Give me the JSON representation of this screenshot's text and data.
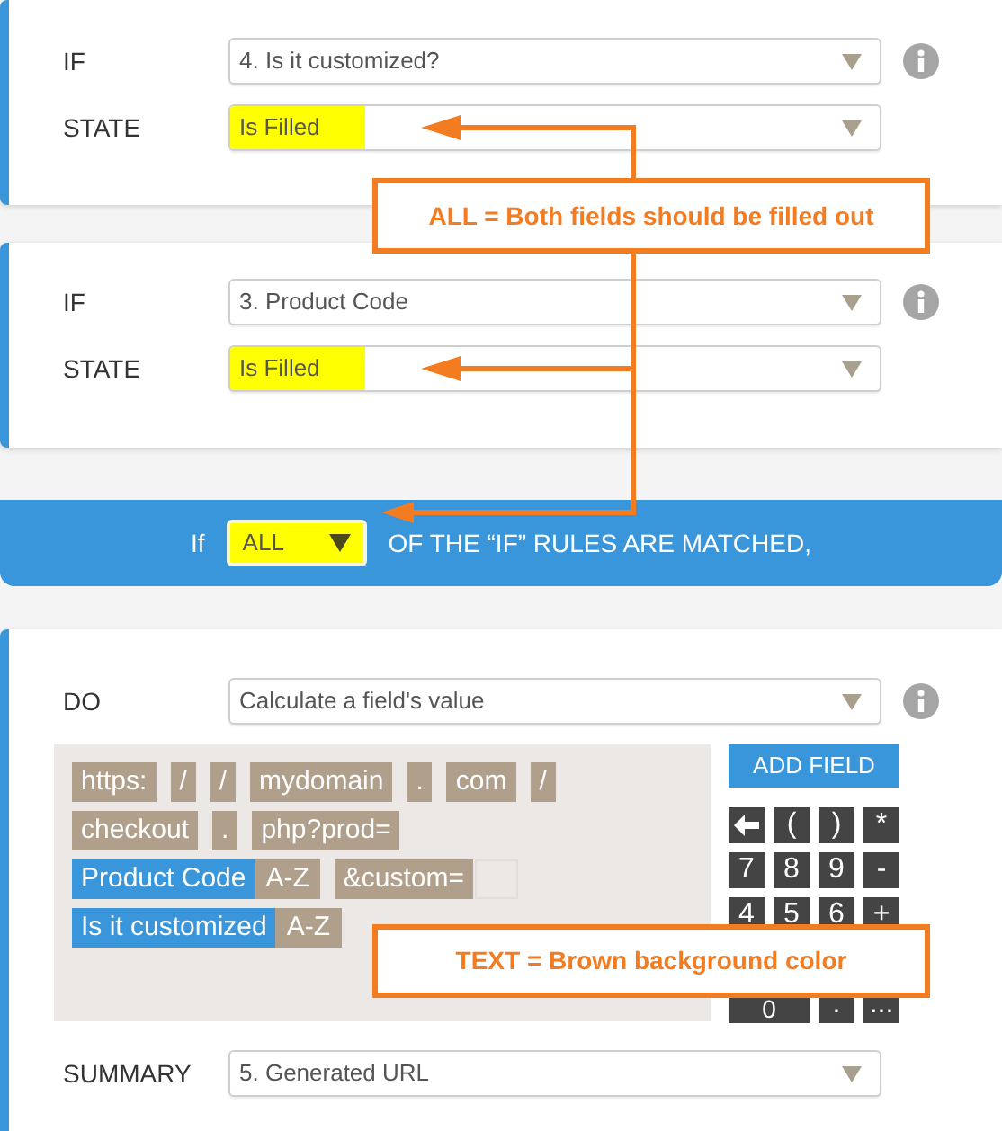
{
  "conditions": [
    {
      "rows": [
        {
          "label": "IF",
          "value": "4. Is it customized?",
          "highlight": false,
          "info": true
        },
        {
          "label": "STATE",
          "value": "Is Filled",
          "highlight": true,
          "info": false
        }
      ]
    },
    {
      "rows": [
        {
          "label": "IF",
          "value": "3. Product Code",
          "highlight": false,
          "info": true
        },
        {
          "label": "STATE",
          "value": "Is Filled",
          "highlight": true,
          "info": false
        }
      ]
    }
  ],
  "match_bar": {
    "prefix": "If",
    "select": "ALL",
    "suffix": "OF THE “IF” RULES ARE MATCHED,"
  },
  "action": {
    "do_label": "DO",
    "do_value": "Calculate a field's value",
    "token_lines": [
      [
        {
          "kind": "text",
          "label": "https:"
        },
        {
          "kind": "text",
          "label": "/"
        },
        {
          "kind": "text",
          "label": "/"
        },
        {
          "kind": "text",
          "label": "mydomain"
        },
        {
          "kind": "text",
          "label": "."
        },
        {
          "kind": "text",
          "label": "com"
        },
        {
          "kind": "text",
          "label": "/"
        }
      ],
      [
        {
          "kind": "text",
          "label": "checkout"
        },
        {
          "kind": "text",
          "label": "."
        },
        {
          "kind": "text",
          "label": "php?prod="
        }
      ],
      [
        {
          "kind": "field",
          "label": "Product Code",
          "format": "A-Z"
        },
        {
          "kind": "text",
          "label": "&custom="
        },
        {
          "kind": "input"
        }
      ],
      [
        {
          "kind": "field",
          "label": "Is it customized",
          "format": "A-Z"
        }
      ]
    ],
    "add_field": "ADD FIELD",
    "keypad": [
      [
        {
          "kind": "icon"
        },
        {
          "kind": "text",
          "label": "("
        },
        {
          "kind": "text",
          "label": ")"
        },
        {
          "kind": "text",
          "label": "*"
        }
      ],
      [
        {
          "kind": "text",
          "label": "7"
        },
        {
          "kind": "text",
          "label": "8"
        },
        {
          "kind": "text",
          "label": "9"
        },
        {
          "kind": "text",
          "label": "-"
        }
      ],
      [
        {
          "kind": "text",
          "label": "4"
        },
        {
          "kind": "text",
          "label": "5"
        },
        {
          "kind": "text",
          "label": "6"
        },
        {
          "kind": "text",
          "label": "+"
        }
      ],
      [
        {
          "kind": "wide",
          "label": "0"
        },
        {
          "kind": "text",
          "label": "."
        },
        {
          "kind": "text",
          "label": "..."
        }
      ]
    ],
    "summary_label": "SUMMARY",
    "summary_value": "5. Generated URL"
  },
  "annotations": [
    "ALL = Both fields should be filled out",
    "TEXT = Brown background color"
  ]
}
